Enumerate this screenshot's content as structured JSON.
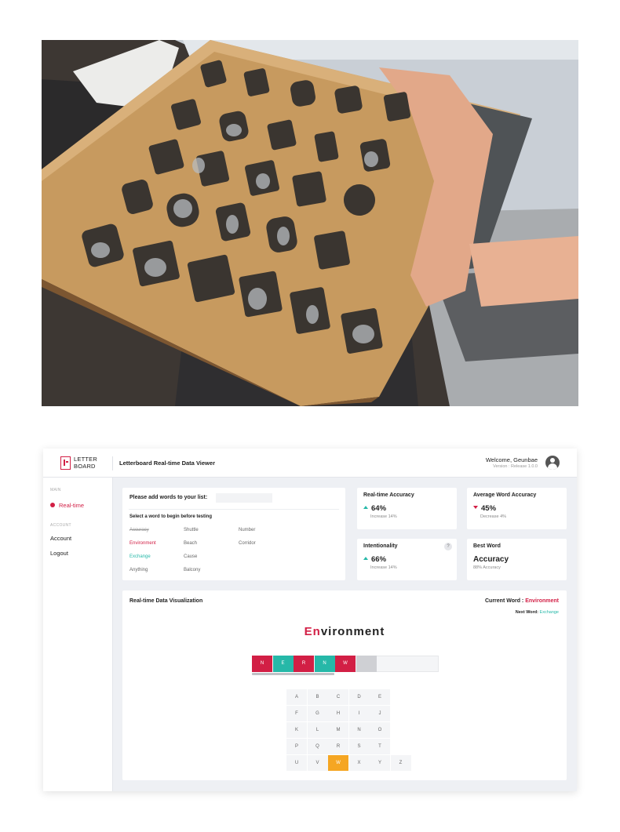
{
  "app": {
    "logo_line1": "LETTER",
    "logo_line2": "BOARD",
    "title": "Letterboard Real-time Data Viewer",
    "welcome": "Welcome, Geunbae",
    "version": "Version : Release 1.0.0"
  },
  "sidebar": {
    "main_section": "MAIN",
    "realtime": "Real-time",
    "account_section": "ACCOUNT",
    "account": "Account",
    "logout": "Logout"
  },
  "word_list": {
    "add_label": "Please add words to your list:",
    "input_value": "",
    "hint": "Select a word to begin before testing",
    "words": [
      {
        "text": "Accuracy",
        "state": "done"
      },
      {
        "text": "Environment",
        "state": "current"
      },
      {
        "text": "Exchange",
        "state": "next"
      },
      {
        "text": "Anything",
        "state": "pending"
      },
      {
        "text": "Shuttle",
        "state": "pending"
      },
      {
        "text": "Beach",
        "state": "pending"
      },
      {
        "text": "Cause",
        "state": "pending"
      },
      {
        "text": "Balcony",
        "state": "pending"
      },
      {
        "text": "Number",
        "state": "pending"
      },
      {
        "text": "Corridor",
        "state": "pending"
      }
    ]
  },
  "stats": {
    "realtime_accuracy": {
      "label": "Real-time Accuracy",
      "value": "64%",
      "trend": "up",
      "sub": "Increase 14%"
    },
    "avg_word_accuracy": {
      "label": "Average Word Accuracy",
      "value": "45%",
      "trend": "down",
      "sub": "Decrease 4%"
    },
    "intentionality": {
      "label": "Intentionality",
      "value": "66%",
      "trend": "up",
      "sub": "Increase 14%",
      "help": "?"
    },
    "best_word": {
      "label": "Best Word",
      "word": "Accuracy",
      "sub": "88% Accuracy"
    }
  },
  "visualization": {
    "title": "Real-time Data Visualization",
    "current_word_label": "Current Word : ",
    "current_word": "Environment",
    "next_word_label": "Next Word: ",
    "next_word": "Exchange",
    "display_typed": "En",
    "display_rest": "vironment",
    "sequence": [
      {
        "letter": "N",
        "status": "wrong"
      },
      {
        "letter": "E",
        "status": "correct"
      },
      {
        "letter": "R",
        "status": "wrong"
      },
      {
        "letter": "N",
        "status": "correct"
      },
      {
        "letter": "W",
        "status": "wrong"
      },
      {
        "letter": "",
        "status": "pending"
      }
    ],
    "sequence_progress": 0.44,
    "keyboard_rows": [
      [
        "A",
        "B",
        "C",
        "D",
        "E"
      ],
      [
        "F",
        "G",
        "H",
        "I",
        "J"
      ],
      [
        "K",
        "L",
        "M",
        "N",
        "O"
      ],
      [
        "P",
        "Q",
        "R",
        "S",
        "T"
      ],
      [
        "U",
        "V",
        "W",
        "X",
        "Y",
        "Z"
      ]
    ],
    "highlighted_key": "W"
  },
  "colors": {
    "accent_red": "#d21f45",
    "accent_teal": "#26b8a8",
    "highlight_orange": "#f5a623",
    "pending_gray": "#cfd0d4"
  }
}
